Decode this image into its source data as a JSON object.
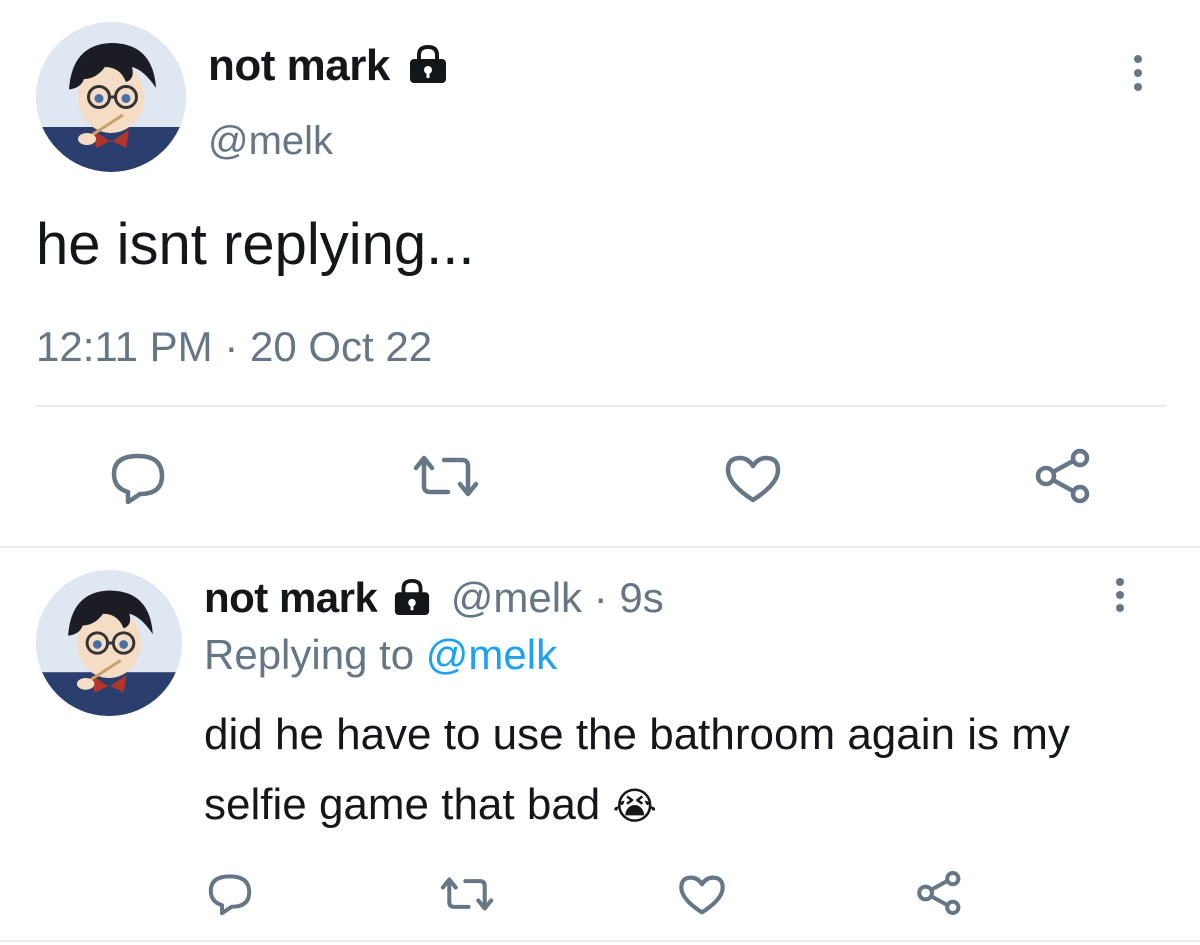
{
  "main_tweet": {
    "display_name": "not mark",
    "handle": "@melk",
    "text": "he isnt replying...",
    "timestamp": "12:11 PM · 20 Oct 22",
    "icons": {
      "lock": "lock-icon",
      "more": "more-icon",
      "reply": "reply-icon",
      "retweet": "retweet-icon",
      "like": "heart-icon",
      "share": "share-icon"
    }
  },
  "reply_tweet": {
    "display_name": "not mark",
    "handle": "@melk",
    "separator": "·",
    "age": "9s",
    "replying_prefix": "Replying to",
    "replying_handle": "@melk",
    "text": "did he have to use the bathroom again is my selfie game that bad",
    "emoji": "😭"
  },
  "colors": {
    "text": "#14171a",
    "secondary": "#657786",
    "link": "#1da1f2",
    "divider": "#e6ecf0"
  }
}
